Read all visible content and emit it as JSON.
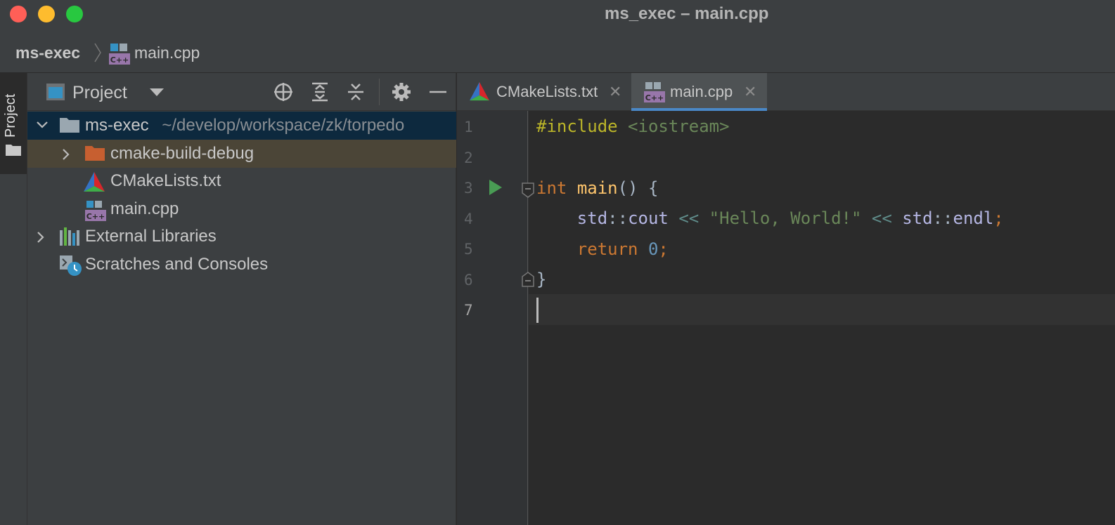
{
  "window": {
    "title": "ms_exec – main.cpp"
  },
  "navbar": {
    "project": "ms-exec",
    "file": "main.cpp"
  },
  "tool_stripe": {
    "project_label": "Project"
  },
  "project_panel": {
    "title": "Project",
    "tree": [
      {
        "label": "ms-exec",
        "path": "~/develop/workspace/zk/torpedo",
        "icon": "folder-icon",
        "expanded": true
      },
      {
        "label": "cmake-build-debug",
        "icon": "folder-orange-icon",
        "expanded": false
      },
      {
        "label": "CMakeLists.txt",
        "icon": "cmake-icon"
      },
      {
        "label": "main.cpp",
        "icon": "cpp-file-icon"
      },
      {
        "label": "External Libraries",
        "icon": "library-icon",
        "expanded": false
      },
      {
        "label": "Scratches and Consoles",
        "icon": "scratches-icon"
      }
    ]
  },
  "editor": {
    "tabs": [
      {
        "label": "CMakeLists.txt",
        "active": false
      },
      {
        "label": "main.cpp",
        "active": true
      }
    ],
    "line_numbers": [
      "1",
      "2",
      "3",
      "4",
      "5",
      "6",
      "7"
    ],
    "current_line": 7,
    "code_tokens": {
      "l1_directive": "#include",
      "l1_header": "<iostream>",
      "l3_type": "int",
      "l3_name": "main",
      "l3_rest": "() {",
      "l4_std1": "std",
      "l4_sep1": "::",
      "l4_cout": "cout",
      "l4_op1": "<<",
      "l4_str": "\"Hello, World!\"",
      "l4_op2": "<<",
      "l4_std2": "std",
      "l4_sep2": "::",
      "l4_endl": "endl",
      "l4_semi": ";",
      "l5_return": "return",
      "l5_zero": "0",
      "l5_semi": ";",
      "l6_brace": "}"
    }
  },
  "colors": {
    "keyword": "#cc7832",
    "function": "#ffc66d",
    "string": "#6a8759",
    "number": "#6897bb",
    "preprocessor": "#bbb529",
    "selection": "#0d293e",
    "tab_underline": "#4a88c7"
  }
}
